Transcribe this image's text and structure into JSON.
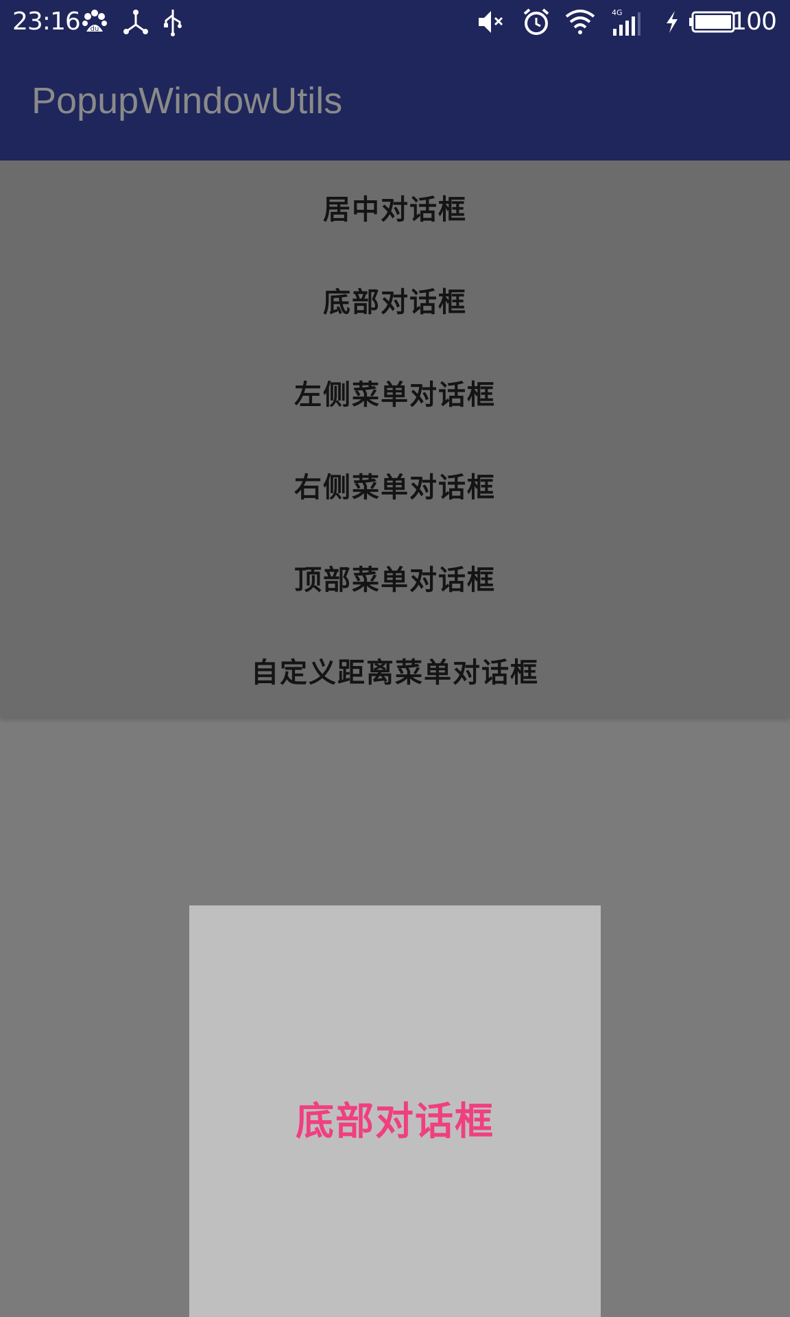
{
  "status_bar": {
    "time": "23:16",
    "battery_level": "100",
    "background_color": "#1f265b",
    "icons": [
      "baidu-paw-icon",
      "network-share-icon",
      "usb-icon",
      "mute-icon",
      "alarm-icon",
      "wifi-icon",
      "signal-4g-icon",
      "charging-icon",
      "battery-icon"
    ]
  },
  "toolbar": {
    "title": "PopupWindowUtils"
  },
  "menu": {
    "items": [
      {
        "label": "居中对话框"
      },
      {
        "label": "底部对话框"
      },
      {
        "label": "左侧菜单对话框"
      },
      {
        "label": "右侧菜单对话框"
      },
      {
        "label": "顶部菜单对话框"
      },
      {
        "label": "自定义距离菜单对话框"
      }
    ]
  },
  "dialog": {
    "text": "底部对话框",
    "accent_color": "#f03f7f",
    "background_color": "#bfbfbf"
  }
}
